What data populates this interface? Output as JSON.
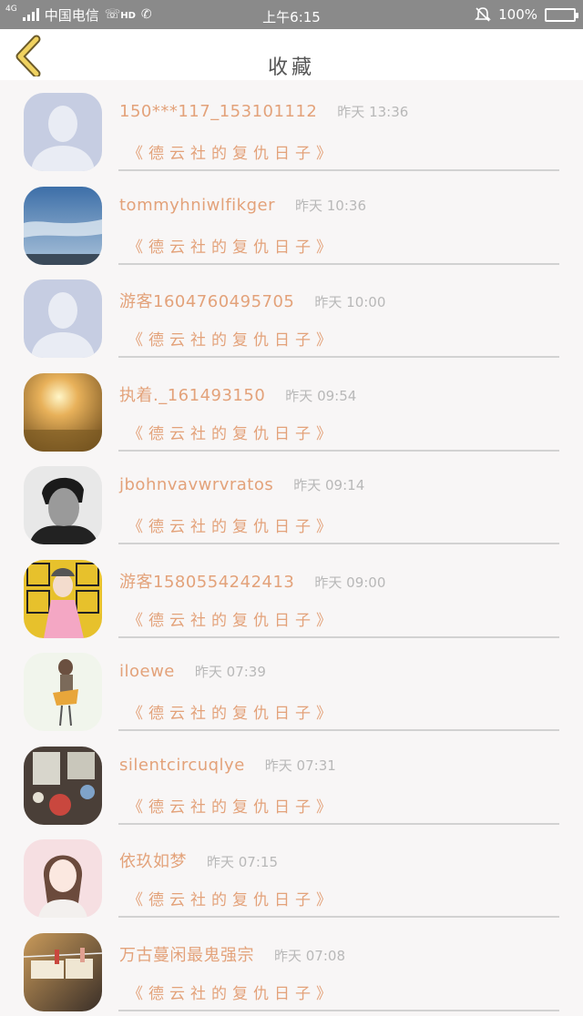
{
  "status_bar": {
    "network": "4G",
    "carrier": "中国电信",
    "hd": "HD",
    "time": "上午6:15",
    "battery": "100%",
    "icons": [
      "signal-icon",
      "hd-call-icon",
      "wifi-call-icon",
      "bell-mute-icon",
      "battery-icon"
    ]
  },
  "header": {
    "title": "收藏",
    "back_icon": "chevron-left-icon",
    "accent_color": "#f0d260"
  },
  "favorites": [
    {
      "user": "150***117_153101112",
      "time": "昨天 13:36",
      "book": "《德云社的复仇日子》",
      "avatar": "default-avatar"
    },
    {
      "user": "tommyhniwlfikger",
      "time": "昨天 10:36",
      "book": "《德云社的复仇日子》",
      "avatar": "sky-photo"
    },
    {
      "user": "游客1604760495705",
      "time": "昨天 10:00",
      "book": "《德云社的复仇日子》",
      "avatar": "default-avatar"
    },
    {
      "user": "执着._161493150",
      "time": "昨天 09:54",
      "book": "《德云社的复仇日子》",
      "avatar": "sunset-photo"
    },
    {
      "user": "jbohnvavwrvratos",
      "time": "昨天 09:14",
      "book": "《德云社的复仇日子》",
      "avatar": "man-portrait"
    },
    {
      "user": "游客1580554242413",
      "time": "昨天 09:00",
      "book": "《德云社的复仇日子》",
      "avatar": "opera-girl"
    },
    {
      "user": "iloewe",
      "time": "昨天 07:39",
      "book": "《德云社的复仇日子》",
      "avatar": "sketch-girl"
    },
    {
      "user": "silentcircuqlye",
      "time": "昨天 07:31",
      "book": "《德云社的复仇日子》",
      "avatar": "ornaments-photo"
    },
    {
      "user": "依玖如梦",
      "time": "昨天 07:15",
      "book": "《德云社的复仇日子》",
      "avatar": "anime-girl"
    },
    {
      "user": "万古蔓闲最鬼强宗",
      "time": "昨天 07:08",
      "book": "《德云社的复仇日子》",
      "avatar": "love-clip-photo"
    }
  ],
  "colors": {
    "username": "#e3a27a",
    "time": "#b8b8b8",
    "book": "#e3a27a",
    "divider": "#d2d2d2",
    "background": "#f8f6f6"
  }
}
